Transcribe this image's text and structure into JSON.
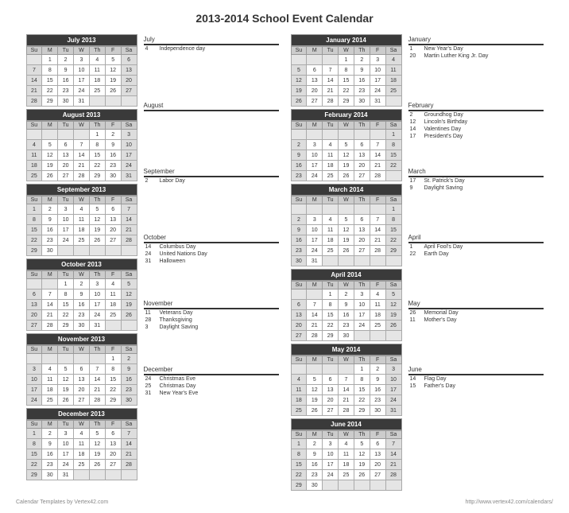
{
  "title": "2013-2014 School Event Calendar",
  "dow": [
    "Su",
    "M",
    "Tu",
    "W",
    "Th",
    "F",
    "Sa"
  ],
  "footer": {
    "left": "Calendar Templates by Vertex42.com",
    "right": "http://www.vertex42.com/calendars/"
  },
  "halves": [
    {
      "months": [
        {
          "name": "July 2013",
          "label": "July",
          "start": 1,
          "days": 31,
          "events": [
            {
              "d": "4",
              "t": "Independence day"
            }
          ]
        },
        {
          "name": "August 2013",
          "label": "August",
          "start": 4,
          "days": 31,
          "events": []
        },
        {
          "name": "September 2013",
          "label": "September",
          "start": 0,
          "days": 30,
          "events": [
            {
              "d": "2",
              "t": "Labor Day"
            }
          ]
        },
        {
          "name": "October 2013",
          "label": "October",
          "start": 2,
          "days": 31,
          "events": [
            {
              "d": "14",
              "t": "Columbus Day"
            },
            {
              "d": "24",
              "t": "United Nations Day"
            },
            {
              "d": "31",
              "t": "Halloween"
            }
          ]
        },
        {
          "name": "November 2013",
          "label": "November",
          "start": 5,
          "days": 30,
          "events": [
            {
              "d": "11",
              "t": "Veterans Day"
            },
            {
              "d": "28",
              "t": "Thanksgiving"
            },
            {
              "d": "3",
              "t": "Daylight Saving"
            }
          ]
        },
        {
          "name": "December 2013",
          "label": "December",
          "start": 0,
          "days": 31,
          "events": [
            {
              "d": "24",
              "t": "Christmas Eve"
            },
            {
              "d": "25",
              "t": "Christmas Day"
            },
            {
              "d": "31",
              "t": "New Year's Eve"
            }
          ]
        }
      ]
    },
    {
      "months": [
        {
          "name": "January 2014",
          "label": "January",
          "start": 3,
          "days": 31,
          "events": [
            {
              "d": "1",
              "t": "New Year's Day"
            },
            {
              "d": "20",
              "t": "Martin Luther King Jr. Day"
            }
          ]
        },
        {
          "name": "February 2014",
          "label": "February",
          "start": 6,
          "days": 28,
          "events": [
            {
              "d": "2",
              "t": "Groundhog Day"
            },
            {
              "d": "12",
              "t": "Lincoln's Birthday"
            },
            {
              "d": "14",
              "t": "Valentines Day"
            },
            {
              "d": "17",
              "t": "President's Day"
            }
          ]
        },
        {
          "name": "March 2014",
          "label": "March",
          "start": 6,
          "days": 31,
          "events": [
            {
              "d": "17",
              "t": "St. Patrick's Day"
            },
            {
              "d": "9",
              "t": "Daylight Saving"
            }
          ]
        },
        {
          "name": "April 2014",
          "label": "April",
          "start": 2,
          "days": 30,
          "events": [
            {
              "d": "1",
              "t": "April Fool's Day"
            },
            {
              "d": "22",
              "t": "Earth Day"
            }
          ]
        },
        {
          "name": "May 2014",
          "label": "May",
          "start": 4,
          "days": 31,
          "events": [
            {
              "d": "26",
              "t": "Memorial Day"
            },
            {
              "d": "11",
              "t": "Mother's Day"
            }
          ]
        },
        {
          "name": "June 2014",
          "label": "June",
          "start": 0,
          "days": 30,
          "events": [
            {
              "d": "14",
              "t": "Flag Day"
            },
            {
              "d": "15",
              "t": "Father's Day"
            }
          ]
        }
      ]
    }
  ]
}
